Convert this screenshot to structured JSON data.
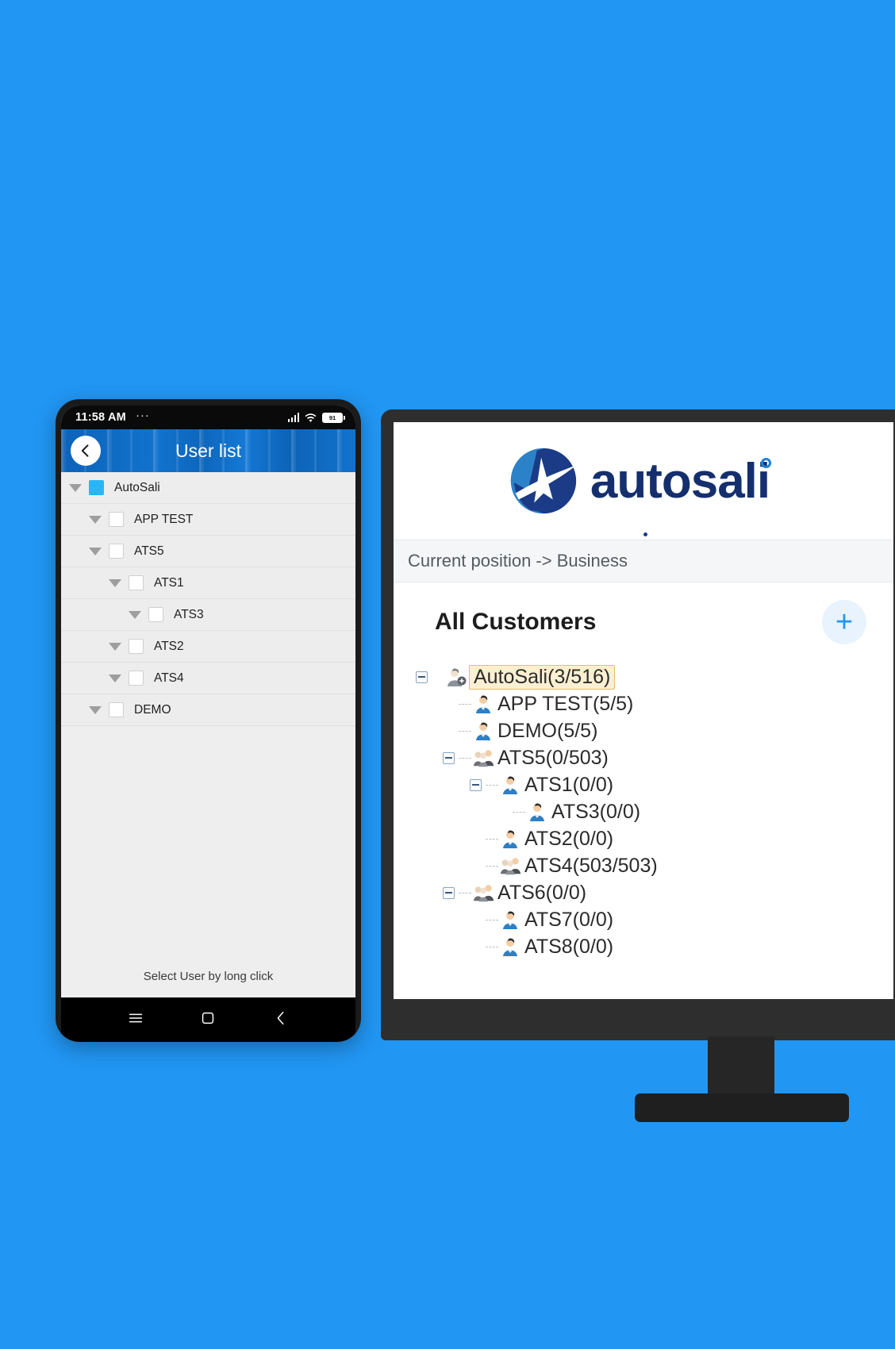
{
  "background_color": "#2196f3",
  "phone": {
    "status_bar": {
      "time": "11:58 AM",
      "dots": "···",
      "signal_icon": "signal-bars-icon",
      "wifi_icon": "wifi-icon",
      "battery_level": "91"
    },
    "app_bar": {
      "back_icon": "back-chevron-icon",
      "title": "User list"
    },
    "tree_rows": [
      {
        "label": "AutoSali",
        "indent": 0,
        "checked": true
      },
      {
        "label": "APP TEST",
        "indent": 1,
        "checked": false
      },
      {
        "label": "ATS5",
        "indent": 1,
        "checked": false
      },
      {
        "label": "ATS1",
        "indent": 2,
        "checked": false
      },
      {
        "label": "ATS3",
        "indent": 3,
        "checked": false
      },
      {
        "label": "ATS2",
        "indent": 2,
        "checked": false
      },
      {
        "label": "ATS4",
        "indent": 2,
        "checked": false
      },
      {
        "label": "DEMO",
        "indent": 1,
        "checked": false
      }
    ],
    "hint": "Select User by long click",
    "nav_bar": {
      "menu_icon": "menu-icon",
      "home_icon": "home-square-icon",
      "back_icon": "back-chevron-icon"
    }
  },
  "desktop": {
    "logo": {
      "mark_icon": "autosali-a-mark-icon",
      "wordmark": "autosali"
    },
    "breadcrumb": "Current position -> Business",
    "panel": {
      "title": "All Customers",
      "add_label": "+",
      "add_icon": "plus-icon"
    },
    "tree_rows": [
      {
        "label": "AutoSali(3/516)",
        "indent": 0,
        "expander": "minus",
        "avatar": "user-admin-icon",
        "selected": true
      },
      {
        "label": "APP TEST(5/5)",
        "indent": 1,
        "expander": "none",
        "avatar": "user-icon",
        "selected": false
      },
      {
        "label": "DEMO(5/5)",
        "indent": 1,
        "expander": "none",
        "avatar": "user-icon",
        "selected": false
      },
      {
        "label": "ATS5(0/503)",
        "indent": 1,
        "expander": "minus",
        "avatar": "user-group-icon",
        "selected": false
      },
      {
        "label": "ATS1(0/0)",
        "indent": 2,
        "expander": "minus",
        "avatar": "user-icon",
        "selected": false
      },
      {
        "label": "ATS3(0/0)",
        "indent": 3,
        "expander": "none",
        "avatar": "user-icon",
        "selected": false
      },
      {
        "label": "ATS2(0/0)",
        "indent": 2,
        "expander": "none",
        "avatar": "user-icon",
        "selected": false
      },
      {
        "label": "ATS4(503/503)",
        "indent": 2,
        "expander": "none",
        "avatar": "user-group-icon",
        "selected": false
      },
      {
        "label": "ATS6(0/0)",
        "indent": 1,
        "expander": "minus",
        "avatar": "user-group-icon",
        "selected": false
      },
      {
        "label": "ATS7(0/0)",
        "indent": 2,
        "expander": "none",
        "avatar": "user-icon",
        "selected": false
      },
      {
        "label": "ATS8(0/0)",
        "indent": 2,
        "expander": "none",
        "avatar": "user-icon",
        "selected": false
      }
    ]
  }
}
